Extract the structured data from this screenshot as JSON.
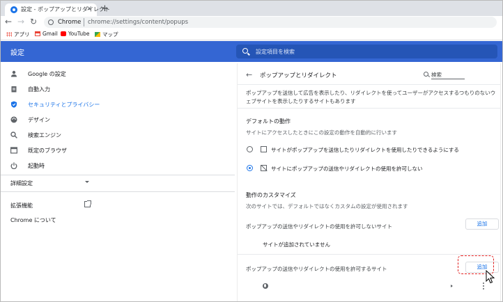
{
  "browser": {
    "tab_title": "設定 - ポップアップとリダイレクト",
    "tab_close": "×",
    "new_tab": "+",
    "omnibox_scheme": "Chrome",
    "omnibox_url": "chrome://settings/content/popups",
    "bookmarks": [
      {
        "label": "アプリ",
        "icon": "apps-grid-icon"
      },
      {
        "label": "Gmail",
        "icon": "gmail-icon"
      },
      {
        "label": "YouTube",
        "icon": "youtube-icon"
      },
      {
        "label": "マップ",
        "icon": "maps-icon"
      }
    ]
  },
  "settings": {
    "title": "設定",
    "search_placeholder": "設定項目を検索",
    "accent": "#1a73e8",
    "header_color": "#3466d3"
  },
  "sidebar": {
    "items": [
      {
        "label": "Google の設定",
        "icon": "person-icon"
      },
      {
        "label": "自動入力",
        "icon": "clipboard-icon"
      },
      {
        "label": "セキュリティとプライバシー",
        "icon": "shield-icon",
        "active": true
      },
      {
        "label": "デザイン",
        "icon": "palette-icon"
      },
      {
        "label": "検索エンジン",
        "icon": "search-icon"
      },
      {
        "label": "既定のブラウザ",
        "icon": "browser-icon"
      },
      {
        "label": "起動時",
        "icon": "power-icon"
      }
    ],
    "advanced": "詳細設定",
    "extensions": "拡張機能",
    "about": "Chrome について"
  },
  "main": {
    "title": "ポップアップとリダイレクト",
    "search_label": "検索",
    "description": "ポップアップを送信して広告を表示したり、リダイレクトを使ってユーザーがアクセスするつもりのないウェブサイトを表示したりするサイトもあります",
    "default_heading": "デフォルトの動作",
    "default_sub": "サイトにアクセスしたときにこの設定の動作を自動的に行います",
    "option_allow": "サイトがポップアップを送信したりリダイレクトを使用したりできるようにする",
    "option_block": "サイトにポップアップの送信やリダイレクトの使用を許可しない",
    "custom_heading": "動作のカスタマイズ",
    "custom_sub": "次のサイトでは、デフォルトではなくカスタムの設定が使用されます",
    "block_list_label": "ポップアップの送信やリダイレクトの使用を許可しないサイト",
    "add_label": "追加",
    "empty_label": "サイトが追加されていません",
    "allow_list_label": "ポップアップの送信やリダイレクトの使用を許可するサイト",
    "highlight_color": "#e11d1d"
  }
}
